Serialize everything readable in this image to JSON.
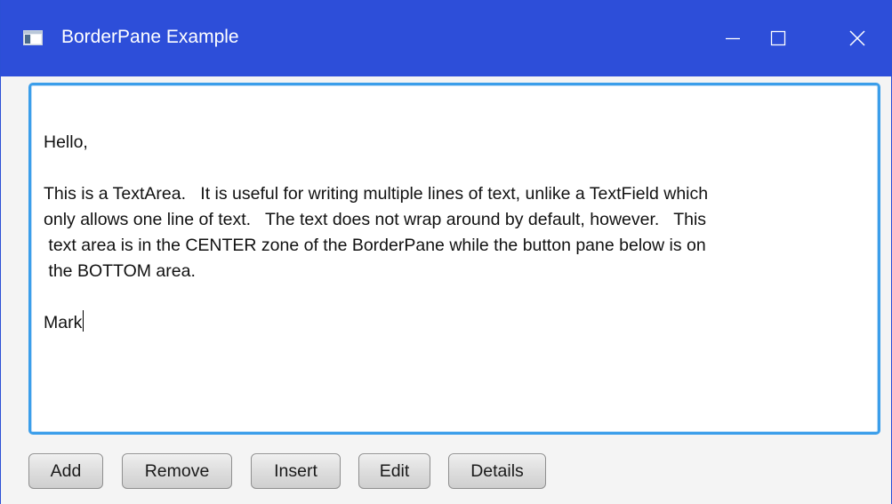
{
  "window": {
    "title": "BorderPane Example",
    "icon": "application-window-icon",
    "controls": {
      "minimize": "minimize-icon",
      "maximize": "maximize-icon",
      "close": "close-icon"
    },
    "accent_color": "#2d4ed9"
  },
  "text_area": {
    "focus_color": "#3b9eea",
    "lines": [
      "Hello,",
      "",
      "This is a TextArea.   It is useful for writing multiple lines of text, unlike a TextField which",
      "only allows one line of text.   The text does not wrap around by default, however.   This",
      " text area is in the CENTER zone of the BorderPane while the button pane below is on",
      " the BOTTOM area.",
      "",
      "Mark"
    ]
  },
  "button_bar": {
    "buttons": [
      {
        "label": "Add"
      },
      {
        "label": "Remove"
      },
      {
        "label": "Insert"
      },
      {
        "label": "Edit"
      },
      {
        "label": "Details"
      }
    ]
  }
}
